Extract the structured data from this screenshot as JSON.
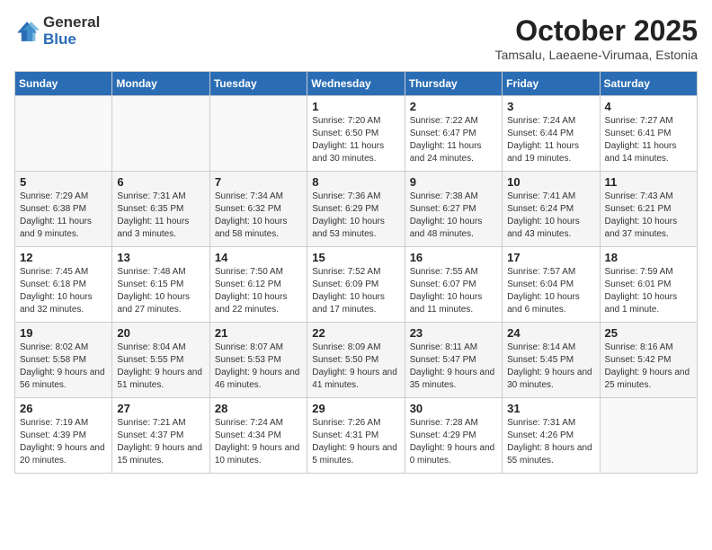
{
  "header": {
    "logo_general": "General",
    "logo_blue": "Blue",
    "month": "October 2025",
    "location": "Tamsalu, Laeaene-Virumaa, Estonia"
  },
  "days_of_week": [
    "Sunday",
    "Monday",
    "Tuesday",
    "Wednesday",
    "Thursday",
    "Friday",
    "Saturday"
  ],
  "weeks": [
    [
      {
        "day": "",
        "info": ""
      },
      {
        "day": "",
        "info": ""
      },
      {
        "day": "",
        "info": ""
      },
      {
        "day": "1",
        "info": "Sunrise: 7:20 AM\nSunset: 6:50 PM\nDaylight: 11 hours\nand 30 minutes."
      },
      {
        "day": "2",
        "info": "Sunrise: 7:22 AM\nSunset: 6:47 PM\nDaylight: 11 hours\nand 24 minutes."
      },
      {
        "day": "3",
        "info": "Sunrise: 7:24 AM\nSunset: 6:44 PM\nDaylight: 11 hours\nand 19 minutes."
      },
      {
        "day": "4",
        "info": "Sunrise: 7:27 AM\nSunset: 6:41 PM\nDaylight: 11 hours\nand 14 minutes."
      }
    ],
    [
      {
        "day": "5",
        "info": "Sunrise: 7:29 AM\nSunset: 6:38 PM\nDaylight: 11 hours\nand 9 minutes."
      },
      {
        "day": "6",
        "info": "Sunrise: 7:31 AM\nSunset: 6:35 PM\nDaylight: 11 hours\nand 3 minutes."
      },
      {
        "day": "7",
        "info": "Sunrise: 7:34 AM\nSunset: 6:32 PM\nDaylight: 10 hours\nand 58 minutes."
      },
      {
        "day": "8",
        "info": "Sunrise: 7:36 AM\nSunset: 6:29 PM\nDaylight: 10 hours\nand 53 minutes."
      },
      {
        "day": "9",
        "info": "Sunrise: 7:38 AM\nSunset: 6:27 PM\nDaylight: 10 hours\nand 48 minutes."
      },
      {
        "day": "10",
        "info": "Sunrise: 7:41 AM\nSunset: 6:24 PM\nDaylight: 10 hours\nand 43 minutes."
      },
      {
        "day": "11",
        "info": "Sunrise: 7:43 AM\nSunset: 6:21 PM\nDaylight: 10 hours\nand 37 minutes."
      }
    ],
    [
      {
        "day": "12",
        "info": "Sunrise: 7:45 AM\nSunset: 6:18 PM\nDaylight: 10 hours\nand 32 minutes."
      },
      {
        "day": "13",
        "info": "Sunrise: 7:48 AM\nSunset: 6:15 PM\nDaylight: 10 hours\nand 27 minutes."
      },
      {
        "day": "14",
        "info": "Sunrise: 7:50 AM\nSunset: 6:12 PM\nDaylight: 10 hours\nand 22 minutes."
      },
      {
        "day": "15",
        "info": "Sunrise: 7:52 AM\nSunset: 6:09 PM\nDaylight: 10 hours\nand 17 minutes."
      },
      {
        "day": "16",
        "info": "Sunrise: 7:55 AM\nSunset: 6:07 PM\nDaylight: 10 hours\nand 11 minutes."
      },
      {
        "day": "17",
        "info": "Sunrise: 7:57 AM\nSunset: 6:04 PM\nDaylight: 10 hours\nand 6 minutes."
      },
      {
        "day": "18",
        "info": "Sunrise: 7:59 AM\nSunset: 6:01 PM\nDaylight: 10 hours\nand 1 minute."
      }
    ],
    [
      {
        "day": "19",
        "info": "Sunrise: 8:02 AM\nSunset: 5:58 PM\nDaylight: 9 hours\nand 56 minutes."
      },
      {
        "day": "20",
        "info": "Sunrise: 8:04 AM\nSunset: 5:55 PM\nDaylight: 9 hours\nand 51 minutes."
      },
      {
        "day": "21",
        "info": "Sunrise: 8:07 AM\nSunset: 5:53 PM\nDaylight: 9 hours\nand 46 minutes."
      },
      {
        "day": "22",
        "info": "Sunrise: 8:09 AM\nSunset: 5:50 PM\nDaylight: 9 hours\nand 41 minutes."
      },
      {
        "day": "23",
        "info": "Sunrise: 8:11 AM\nSunset: 5:47 PM\nDaylight: 9 hours\nand 35 minutes."
      },
      {
        "day": "24",
        "info": "Sunrise: 8:14 AM\nSunset: 5:45 PM\nDaylight: 9 hours\nand 30 minutes."
      },
      {
        "day": "25",
        "info": "Sunrise: 8:16 AM\nSunset: 5:42 PM\nDaylight: 9 hours\nand 25 minutes."
      }
    ],
    [
      {
        "day": "26",
        "info": "Sunrise: 7:19 AM\nSunset: 4:39 PM\nDaylight: 9 hours\nand 20 minutes."
      },
      {
        "day": "27",
        "info": "Sunrise: 7:21 AM\nSunset: 4:37 PM\nDaylight: 9 hours\nand 15 minutes."
      },
      {
        "day": "28",
        "info": "Sunrise: 7:24 AM\nSunset: 4:34 PM\nDaylight: 9 hours\nand 10 minutes."
      },
      {
        "day": "29",
        "info": "Sunrise: 7:26 AM\nSunset: 4:31 PM\nDaylight: 9 hours\nand 5 minutes."
      },
      {
        "day": "30",
        "info": "Sunrise: 7:28 AM\nSunset: 4:29 PM\nDaylight: 9 hours\nand 0 minutes."
      },
      {
        "day": "31",
        "info": "Sunrise: 7:31 AM\nSunset: 4:26 PM\nDaylight: 8 hours\nand 55 minutes."
      },
      {
        "day": "",
        "info": ""
      }
    ]
  ]
}
